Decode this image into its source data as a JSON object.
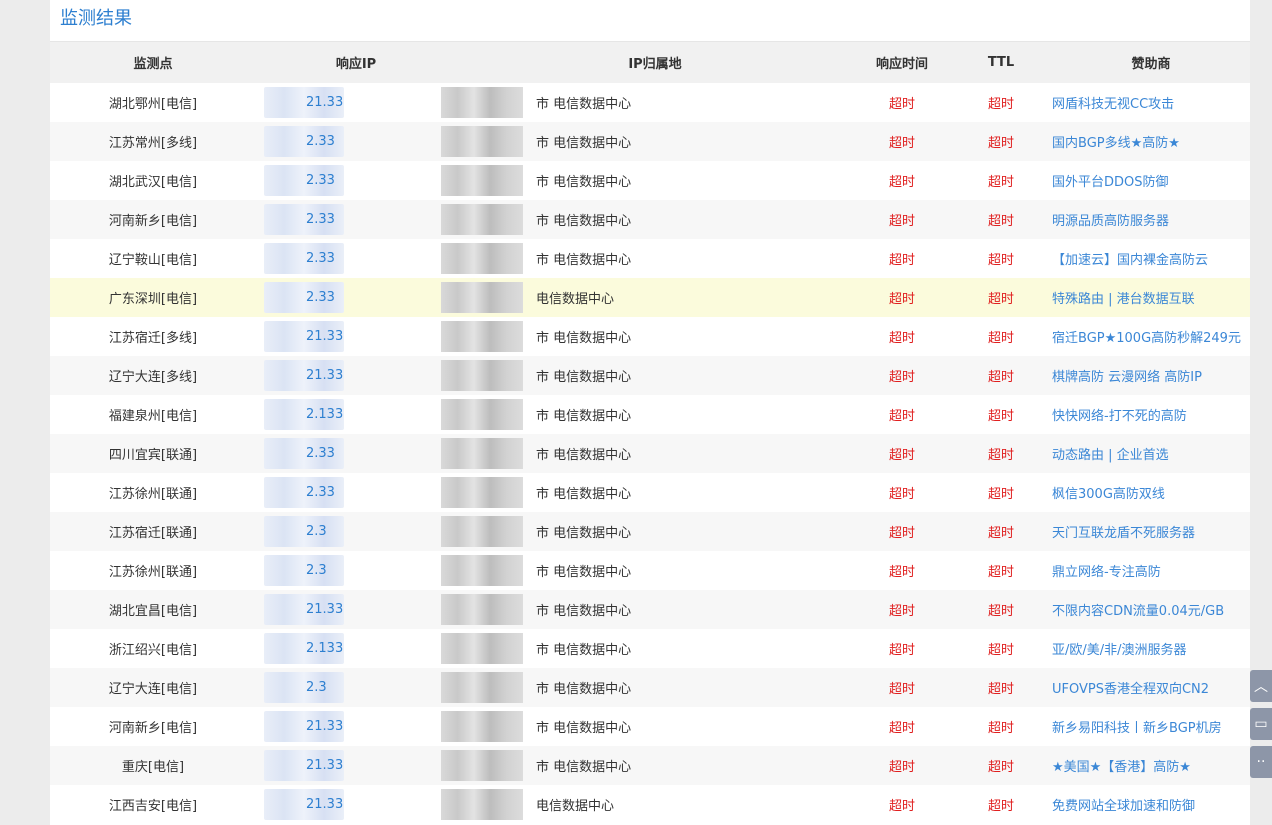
{
  "title": "监测结果",
  "columns": {
    "point": "监测点",
    "ip": "响应IP",
    "location": "IP归属地",
    "time": "响应时间",
    "ttl": "TTL",
    "sponsor": "赞助商"
  },
  "rows": [
    {
      "point": "湖北鄂州[电信]",
      "ip": "21.33",
      "loc": "市 电信数据中心",
      "time": "超时",
      "ttl": "超时",
      "sponsor": "网盾科技无视CC攻击"
    },
    {
      "point": "江苏常州[多线]",
      "ip": "2.33",
      "loc": "市 电信数据中心",
      "time": "超时",
      "ttl": "超时",
      "sponsor": "国内BGP多线★高防★"
    },
    {
      "point": "湖北武汉[电信]",
      "ip": "2.33",
      "loc": "市 电信数据中心",
      "time": "超时",
      "ttl": "超时",
      "sponsor": "国外平台DDOS防御"
    },
    {
      "point": "河南新乡[电信]",
      "ip": "2.33",
      "loc": "市 电信数据中心",
      "time": "超时",
      "ttl": "超时",
      "sponsor": "明源品质高防服务器"
    },
    {
      "point": "辽宁鞍山[电信]",
      "ip": "2.33",
      "loc": "市 电信数据中心",
      "time": "超时",
      "ttl": "超时",
      "sponsor": "【加速云】国内裸金高防云"
    },
    {
      "point": "广东深圳[电信]",
      "ip": "2.33",
      "loc": "电信数据中心",
      "time": "超时",
      "ttl": "超时",
      "sponsor": "特殊路由 | 港台数据互联"
    },
    {
      "point": "江苏宿迁[多线]",
      "ip": "21.33",
      "loc": "市 电信数据中心",
      "time": "超时",
      "ttl": "超时",
      "sponsor": "宿迁BGP★100G高防秒解249元"
    },
    {
      "point": "辽宁大连[多线]",
      "ip": "21.33",
      "loc": "市 电信数据中心",
      "time": "超时",
      "ttl": "超时",
      "sponsor": "棋牌高防 云漫网络 高防IP"
    },
    {
      "point": "福建泉州[电信]",
      "ip": "2.133",
      "loc": "市 电信数据中心",
      "time": "超时",
      "ttl": "超时",
      "sponsor": "快快网络-打不死的高防"
    },
    {
      "point": "四川宜宾[联通]",
      "ip": "2.33",
      "loc": "市 电信数据中心",
      "time": "超时",
      "ttl": "超时",
      "sponsor": "动态路由 | 企业首选"
    },
    {
      "point": "江苏徐州[联通]",
      "ip": "2.33",
      "loc": "市 电信数据中心",
      "time": "超时",
      "ttl": "超时",
      "sponsor": "枫信300G高防双线"
    },
    {
      "point": "江苏宿迁[联通]",
      "ip": "2.3",
      "loc": "市 电信数据中心",
      "time": "超时",
      "ttl": "超时",
      "sponsor": "天门互联龙盾不死服务器"
    },
    {
      "point": "江苏徐州[联通]",
      "ip": "2.3",
      "loc": "市 电信数据中心",
      "time": "超时",
      "ttl": "超时",
      "sponsor": "鼎立网络-专注高防"
    },
    {
      "point": "湖北宜昌[电信]",
      "ip": "21.33",
      "loc": "市 电信数据中心",
      "time": "超时",
      "ttl": "超时",
      "sponsor": "不限内容CDN流量0.04元/GB"
    },
    {
      "point": "浙江绍兴[电信]",
      "ip": "2.133",
      "loc": "市 电信数据中心",
      "time": "超时",
      "ttl": "超时",
      "sponsor": "亚/欧/美/非/澳洲服务器"
    },
    {
      "point": "辽宁大连[电信]",
      "ip": "2.3",
      "loc": "市 电信数据中心",
      "time": "超时",
      "ttl": "超时",
      "sponsor": "UFOVPS香港全程双向CN2"
    },
    {
      "point": "河南新乡[电信]",
      "ip": "21.33",
      "loc": "市 电信数据中心",
      "time": "超时",
      "ttl": "超时",
      "sponsor": "新乡易阳科技丨新乡BGP机房"
    },
    {
      "point": "重庆[电信]",
      "ip": "21.33",
      "loc": "市 电信数据中心",
      "time": "超时",
      "ttl": "超时",
      "sponsor": "★美国★【香港】高防★"
    },
    {
      "point": "江西吉安[电信]",
      "ip": "21.33",
      "loc": "电信数据中心",
      "time": "超时",
      "ttl": "超时",
      "sponsor": "免费网站全球加速和防御"
    }
  ],
  "highlight_row": 5,
  "float_buttons": [
    "chevron-up-icon",
    "comment-icon",
    "more-icon"
  ]
}
